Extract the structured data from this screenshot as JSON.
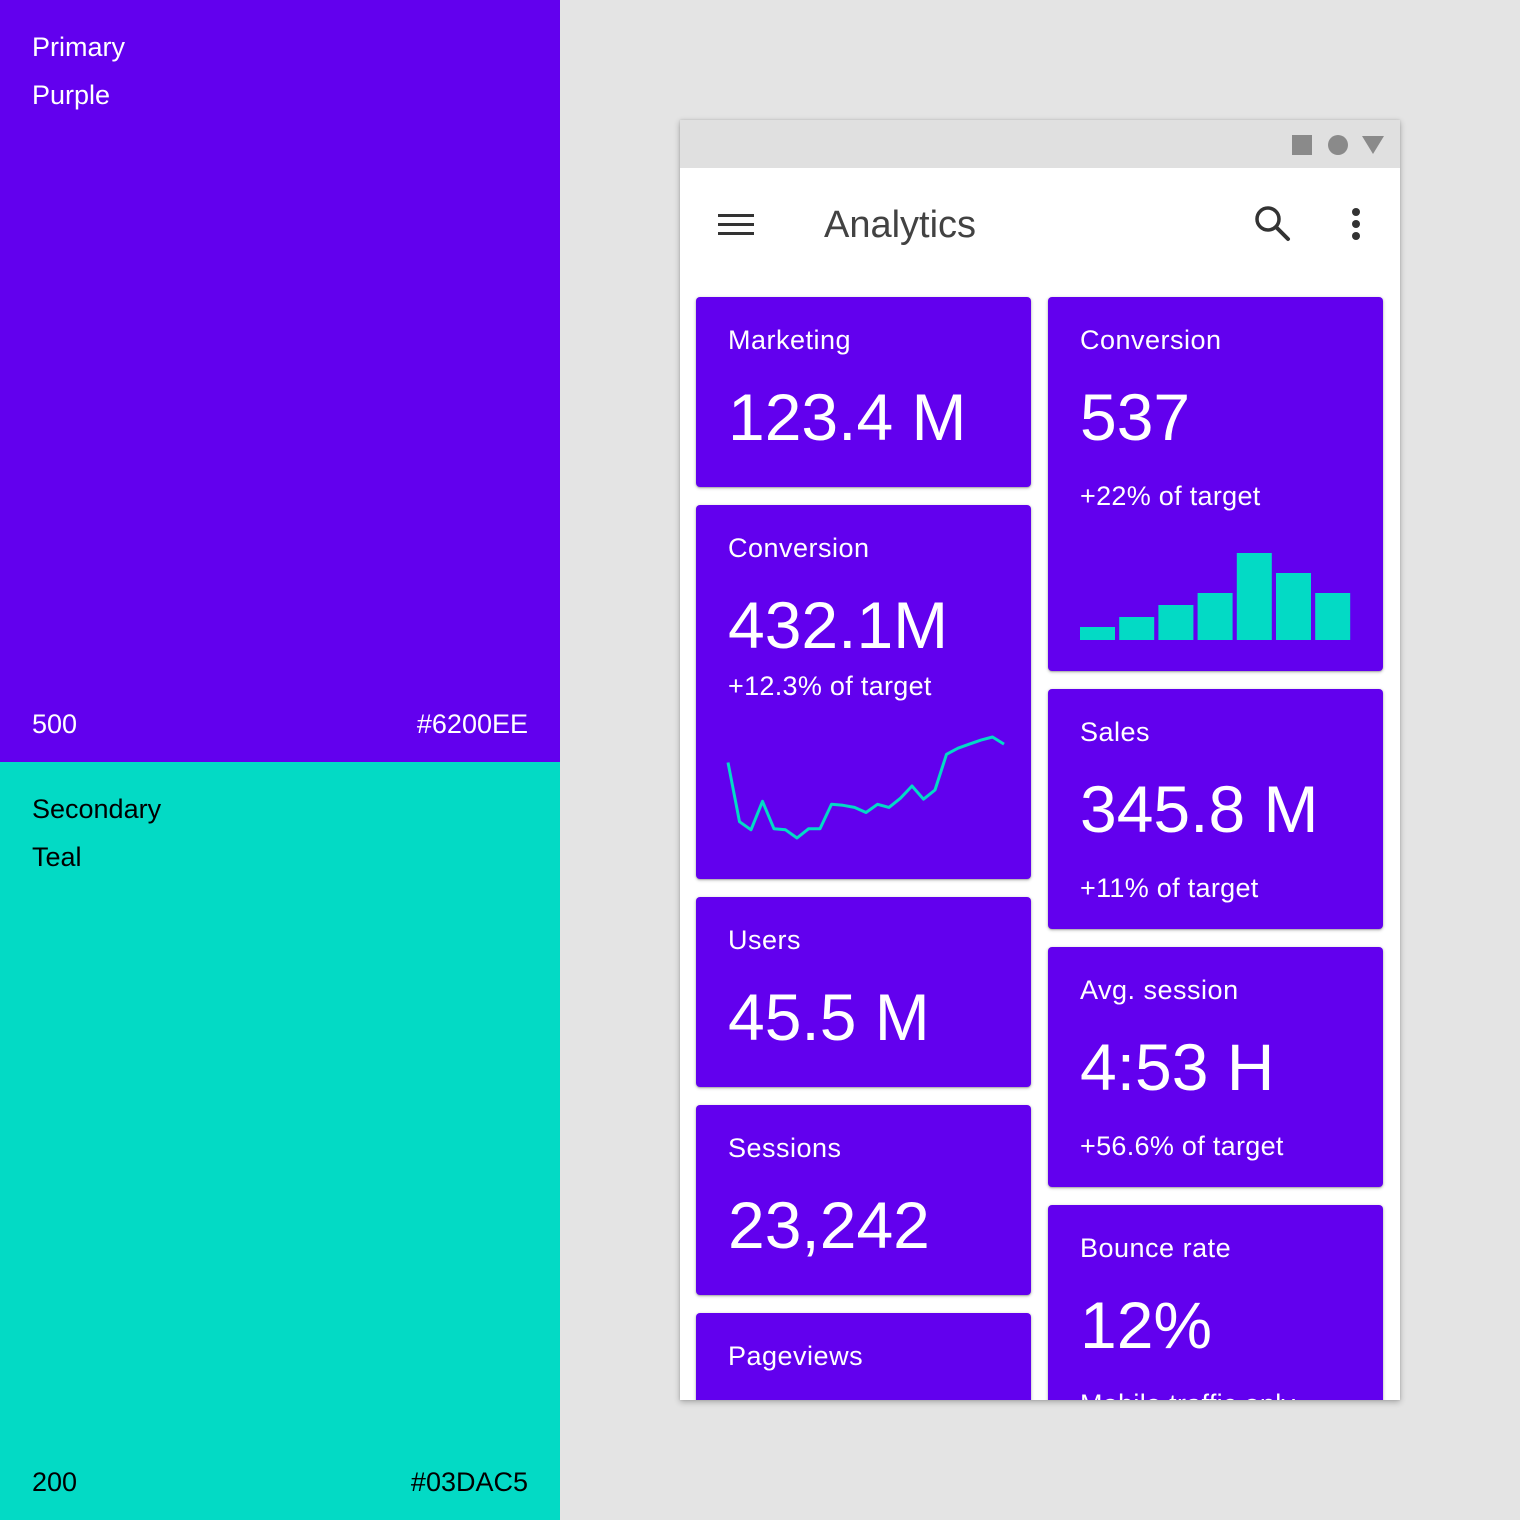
{
  "palette": {
    "primary": {
      "name_line1": "Primary",
      "name_line2": "Purple",
      "weight": "500",
      "hex": "#6200EE",
      "color": "#6200EE"
    },
    "secondary": {
      "name_line1": "Secondary",
      "name_line2": "Teal",
      "weight": "200",
      "hex": "#03DAC5",
      "color": "#03DAC5"
    }
  },
  "status_bar": {
    "icons": [
      "square-icon",
      "circle-icon",
      "triangle-icon"
    ]
  },
  "app_bar": {
    "title": "Analytics",
    "icons": [
      "menu-icon",
      "search-icon",
      "more-vert-icon"
    ]
  },
  "cards": {
    "marketing": {
      "label": "Marketing",
      "value": "123.4 M"
    },
    "conversion_bar": {
      "label": "Conversion",
      "value": "537",
      "sub": "+22% of target"
    },
    "conversion_line": {
      "label": "Conversion",
      "value": "432.1M",
      "sub": "+12.3% of target"
    },
    "sales": {
      "label": "Sales",
      "value": "345.8 M",
      "sub": "+11% of target"
    },
    "users": {
      "label": "Users",
      "value": "45.5 M"
    },
    "avg_session": {
      "label": "Avg. session",
      "value": "4:53 H",
      "sub": "+56.6% of target"
    },
    "sessions": {
      "label": "Sessions",
      "value": "23,242"
    },
    "bounce_rate": {
      "label": "Bounce rate",
      "value": "12%",
      "sub": "Mobile traffic only"
    },
    "pageviews": {
      "label": "Pageviews"
    }
  },
  "chart_data": [
    {
      "type": "bar",
      "values": [
        13,
        23,
        35,
        47,
        87,
        67,
        47
      ],
      "color": "#03DAC5"
    },
    {
      "type": "line",
      "values": [
        75,
        17,
        9,
        37,
        10,
        9,
        1,
        10,
        10,
        34,
        33,
        31,
        26,
        34,
        31,
        40,
        52,
        39,
        48,
        83,
        89,
        93,
        97,
        100,
        93
      ],
      "color": "#03DAC5"
    }
  ]
}
